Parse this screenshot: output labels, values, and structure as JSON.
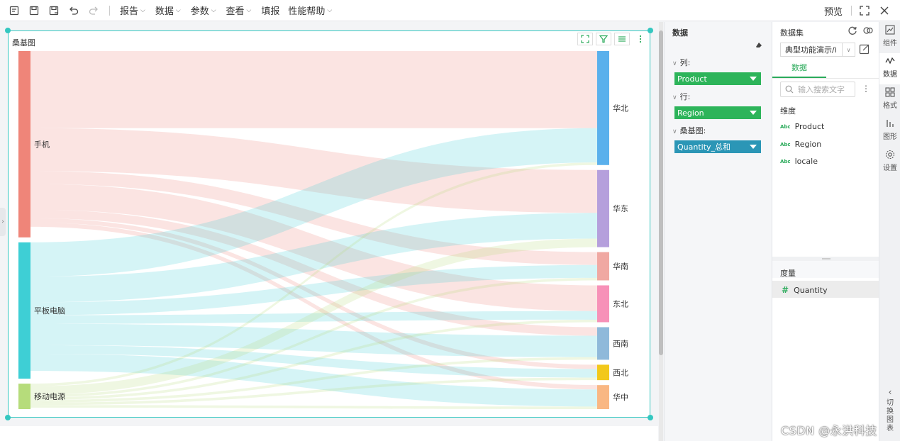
{
  "toolbar": {
    "menus": [
      {
        "label": "报告"
      },
      {
        "label": "数据"
      },
      {
        "label": "参数"
      },
      {
        "label": "查看"
      },
      {
        "label": "填报"
      },
      {
        "label": "性能帮助"
      }
    ],
    "preview_label": "预览"
  },
  "chart": {
    "title": "桑基图"
  },
  "chart_data": {
    "type": "sankey",
    "title": "桑基图",
    "sources": [
      {
        "name": "手机",
        "color": "#ef8579"
      },
      {
        "name": "平板电脑",
        "color": "#3ecfd5"
      },
      {
        "name": "移动电源",
        "color": "#b6dc7b"
      }
    ],
    "targets": [
      {
        "name": "华北",
        "color": "#5ab0ec"
      },
      {
        "name": "华东",
        "color": "#b59fdc"
      },
      {
        "name": "华南",
        "color": "#f0a8a2"
      },
      {
        "name": "东北",
        "color": "#f791b8"
      },
      {
        "name": "西南",
        "color": "#8fb9da"
      },
      {
        "name": "西北",
        "color": "#f2c81b"
      },
      {
        "name": "华中",
        "color": "#f9b783"
      }
    ],
    "links": [
      {
        "source": "手机",
        "target": "华北",
        "value": 90
      },
      {
        "source": "手机",
        "target": "华东",
        "value": 50
      },
      {
        "source": "手机",
        "target": "华南",
        "value": 15
      },
      {
        "source": "手机",
        "target": "东北",
        "value": 30
      },
      {
        "source": "手机",
        "target": "西南",
        "value": 10
      },
      {
        "source": "手机",
        "target": "西北",
        "value": 5
      },
      {
        "source": "手机",
        "target": "华中",
        "value": 5
      },
      {
        "source": "平板电脑",
        "target": "华北",
        "value": 40
      },
      {
        "source": "平板电脑",
        "target": "华东",
        "value": 30
      },
      {
        "source": "平板电脑",
        "target": "华南",
        "value": 15
      },
      {
        "source": "平板电脑",
        "target": "东北",
        "value": 10
      },
      {
        "source": "平板电脑",
        "target": "西南",
        "value": 25
      },
      {
        "source": "平板电脑",
        "target": "西北",
        "value": 10
      },
      {
        "source": "平板电脑",
        "target": "华中",
        "value": 20
      },
      {
        "source": "移动电源",
        "target": "华北",
        "value": 3
      },
      {
        "source": "移动电源",
        "target": "华东",
        "value": 10
      },
      {
        "source": "移动电源",
        "target": "华南",
        "value": 3
      },
      {
        "source": "移动电源",
        "target": "东北",
        "value": 3
      },
      {
        "source": "移动电源",
        "target": "西南",
        "value": 3
      },
      {
        "source": "移动电源",
        "target": "西北",
        "value": 3
      },
      {
        "source": "移动电源",
        "target": "华中",
        "value": 3
      }
    ]
  },
  "data_panel": {
    "title": "数据",
    "sections": [
      {
        "label": "列:",
        "field": "Product",
        "color": "#2db45a"
      },
      {
        "label": "行:",
        "field": "Region",
        "color": "#2db45a"
      },
      {
        "label": "桑基图:",
        "field": "Quantity_总和",
        "color": "#2b96b6"
      }
    ]
  },
  "dataset_panel": {
    "title": "数据集",
    "selected_dataset": "典型功能演示/i",
    "tab_label": "数据",
    "search_placeholder": "输入搜索文字",
    "dimension_label": "维度",
    "dimensions": [
      "Product",
      "Region",
      "locale"
    ],
    "abc_badge": "Abc",
    "measure_label": "度量",
    "measures": [
      "Quantity"
    ],
    "measure_badge": "#"
  },
  "side_tabs": [
    {
      "label": "组件",
      "icon": "component-icon"
    },
    {
      "label": "数据",
      "icon": "data-icon"
    },
    {
      "label": "格式",
      "icon": "format-icon"
    },
    {
      "label": "图形",
      "icon": "graph-icon"
    },
    {
      "label": "设置",
      "icon": "settings-icon"
    }
  ],
  "side_toggle": {
    "chars": [
      "切",
      "换",
      "图",
      "表"
    ]
  },
  "watermark": "CSDN @永洪科技"
}
